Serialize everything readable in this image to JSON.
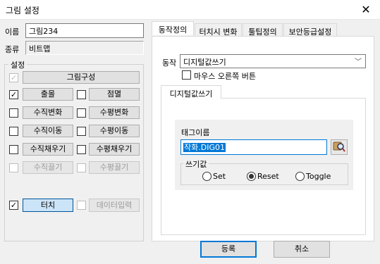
{
  "window": {
    "title": "그림 설정",
    "close_icon": "close-icon"
  },
  "left": {
    "name_label": "이름",
    "name_value": "그림234",
    "type_label": "종류",
    "type_value": "비트맵",
    "settings_group": "설정",
    "items": {
      "draw_config": {
        "label": "그림구성",
        "checked": true,
        "disabled": true
      },
      "output": {
        "label": "출몰",
        "checked": true
      },
      "blink": {
        "label": "점멸",
        "checked": false
      },
      "vmove_change": {
        "label": "수직변화",
        "checked": false
      },
      "hmove_change": {
        "label": "수평변화",
        "checked": false
      },
      "vmove": {
        "label": "수직이동",
        "checked": false
      },
      "hmove": {
        "label": "수평이동",
        "checked": false
      },
      "vfill": {
        "label": "수직채우기",
        "checked": false
      },
      "hfill": {
        "label": "수평채우기",
        "checked": false
      },
      "vdrag": {
        "label": "수직끌기",
        "checked": false,
        "disabled": true
      },
      "hdrag": {
        "label": "수평끌기",
        "checked": false,
        "disabled": true
      },
      "touch": {
        "label": "터치",
        "checked": true
      },
      "data_input": {
        "label": "데이터입력",
        "checked": false,
        "disabled": true
      }
    }
  },
  "tabs": [
    {
      "label": "동작정의",
      "active": true
    },
    {
      "label": "터치시 변화",
      "active": false
    },
    {
      "label": "툴팁정의",
      "active": false
    },
    {
      "label": "보안등급설정",
      "active": false
    }
  ],
  "action": {
    "label": "동작",
    "selected": "디지털값쓰기",
    "right_button_label": "마우스 오른쪽 버튼",
    "right_button_checked": false
  },
  "subtab": {
    "label": "디지털값쓰기"
  },
  "tag": {
    "label": "태그이름",
    "value": "작화.DIG01",
    "browse_icon": "tag-browse-icon"
  },
  "write_value": {
    "label": "쓰기값",
    "options": [
      {
        "label": "Set",
        "checked": false
      },
      {
        "label": "Reset",
        "checked": true
      },
      {
        "label": "Toggle",
        "checked": false
      }
    ]
  },
  "buttons": {
    "ok": "등록",
    "cancel": "취소"
  }
}
